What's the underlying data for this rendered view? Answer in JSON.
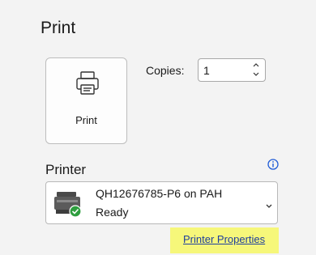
{
  "page": {
    "title": "Print"
  },
  "print_button": {
    "label": "Print",
    "icon": "printer-icon"
  },
  "copies": {
    "label": "Copies:",
    "value": "1"
  },
  "printer": {
    "section_label": "Printer",
    "selected_name": "QH12676785-P6 on PAH",
    "selected_status": "Ready",
    "properties_link": "Printer Properties"
  },
  "colors": {
    "highlight": "#f6f77a",
    "link": "#1f3f9c",
    "status_ok": "#2e9e3e"
  }
}
